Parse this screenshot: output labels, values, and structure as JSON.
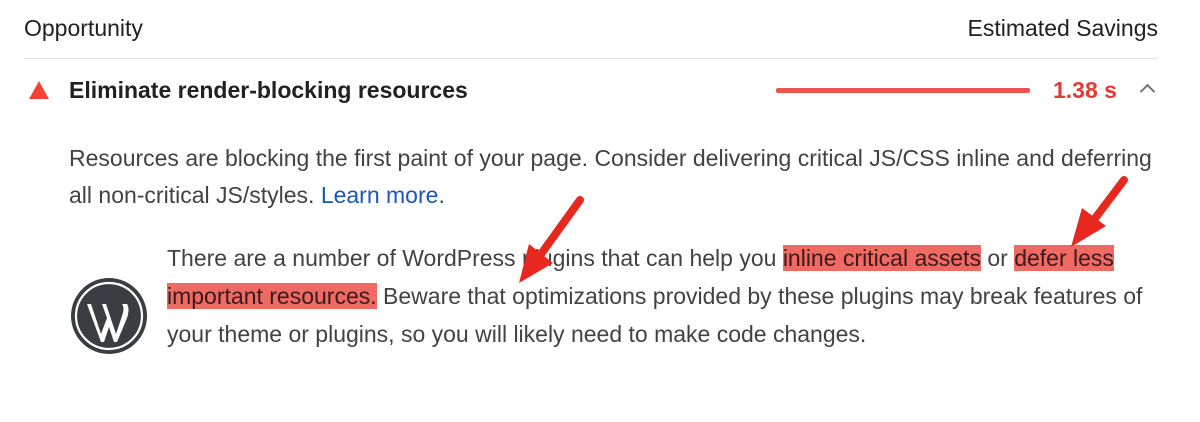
{
  "header": {
    "left_label": "Opportunity",
    "right_label": "Estimated Savings"
  },
  "audit": {
    "title": "Eliminate render-blocking resources",
    "savings_value": "1.38 s",
    "savings_fraction": 1.0,
    "status_color": "#f44336",
    "icon": "warning-triangle-icon",
    "expand_icon": "chevron-up-icon"
  },
  "description": {
    "text": "Resources are blocking the first paint of your page. Consider delivering critical JS/CSS inline and deferring all non-critical JS/styles.",
    "link_text": "Learn more",
    "trailing": "."
  },
  "note": {
    "logo_icon": "wordpress-logo-icon",
    "part1": "There are a number of WordPress plugins that can help you ",
    "highlight1": "inline critical assets",
    "part2": " or ",
    "highlight2": "defer less important resources.",
    "part3": " Beware that optimizations provided by these plugins may break features of your theme or plugins, so you will likely need to make code changes.",
    "highlight_color": "#ef6a63",
    "arrow_color": "#e8271e"
  },
  "colors": {
    "accent_red": "#e53935",
    "link_blue": "#1a57b8"
  }
}
